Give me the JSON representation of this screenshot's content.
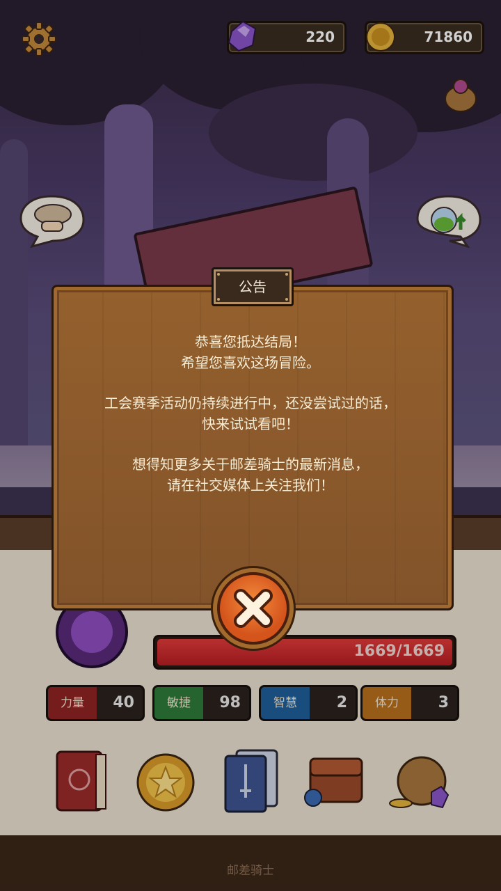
{
  "hud": {
    "gems": "220",
    "coins": "71860"
  },
  "modal": {
    "title": "公告",
    "line1": "恭喜您抵达结局！",
    "line2": "希望您喜欢这场冒险。",
    "line3": "工会赛季活动仍持续进行中，还没尝试过的话，",
    "line4": "快来试试看吧！",
    "line5": "想得知更多关于邮差骑士的最新消息，",
    "line6": "请在社交媒体上关注我们！"
  },
  "hero": {
    "hp": "1669/1669",
    "hp_fraction": 1.0
  },
  "stats": [
    {
      "label": "力量",
      "value": "40",
      "color": "#8f2323"
    },
    {
      "label": "敏捷",
      "value": "98",
      "color": "#2f7a3a"
    },
    {
      "label": "智慧",
      "value": "2",
      "color": "#1f5f99"
    },
    {
      "label": "体力",
      "value": "3",
      "color": "#b8701c"
    }
  ],
  "footer": {
    "title": "邮差骑士"
  },
  "icons": [
    "gear-icon",
    "gem-icon",
    "coin-icon",
    "loot-bag-icon",
    "hat-bubble-icon",
    "potion-upgrade-icon",
    "emblem-icon",
    "spellbook-icon",
    "star-coin-icon",
    "cards-icon",
    "backpack-icon",
    "treasure-bag-icon",
    "close-icon"
  ]
}
